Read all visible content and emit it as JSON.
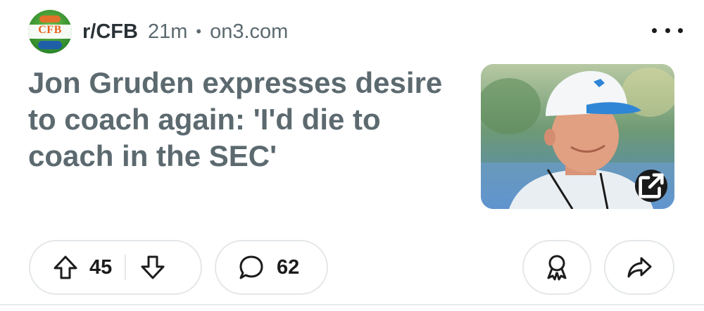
{
  "header": {
    "avatar_text": "CFB",
    "subreddit": "r/CFB",
    "time": "21m",
    "separator": "•",
    "domain": "on3.com"
  },
  "post": {
    "title": "Jon Gruden expresses desire to coach again: 'I'd die to coach in the SEC'"
  },
  "actions": {
    "upvotes": "45",
    "comments": "62"
  },
  "icons": {
    "more": "more-horizontal-icon",
    "external_link": "external-link-icon",
    "upvote": "upvote-arrow-icon",
    "downvote": "downvote-arrow-icon",
    "comment": "comment-bubble-icon",
    "award": "award-icon",
    "share": "share-arrow-icon"
  },
  "colors": {
    "title": "#5c6a70",
    "subreddit": "#2a3236",
    "meta": "#5c6a70",
    "pill_border": "#e4e7e9"
  }
}
